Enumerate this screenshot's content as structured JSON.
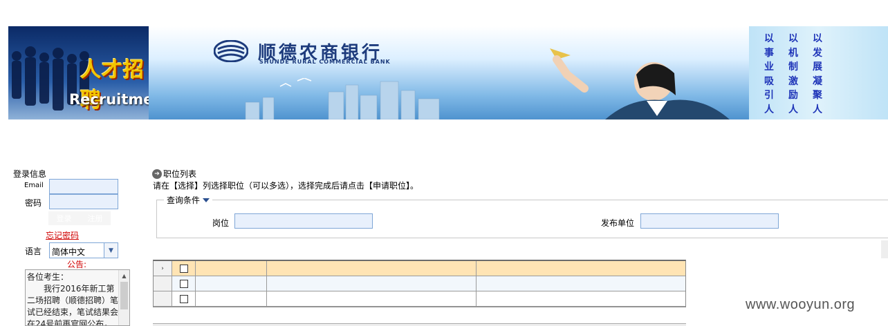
{
  "banner": {
    "recruit_cn": "人才招聘",
    "recruit_en": "Recruitment",
    "bank_name_cn": "顺德农商银行",
    "bank_name_en": "SHUNDE RURAL COMMERCIAL BANK",
    "motto_columns": [
      [
        "以",
        "事",
        "业",
        "吸",
        "引",
        "人"
      ],
      [
        "以",
        "机",
        "制",
        "激",
        "励",
        "人"
      ],
      [
        "以",
        "发",
        "展",
        "凝",
        "聚",
        "人"
      ]
    ]
  },
  "login": {
    "title": "登录信息",
    "email_label": "Email",
    "email_value": "",
    "password_label": "密码",
    "password_value": "",
    "login_button": "登录",
    "register_button": "注册",
    "forgot_link": "忘记密码",
    "language_label": "语言",
    "language_value": "简体中文",
    "notice_title": "公告:",
    "notice_text": "各位考生：\n　　我行2016年新工第二场招聘（顺德招聘）笔试已经结束，笔试结果会在24号前再官网公布，届时请留意……"
  },
  "main": {
    "section_title": "职位列表",
    "instruction": "请在【选择】列选择职位（可以多选），选择完成后请点击【申请职位】。",
    "query_legend": "查询条件",
    "post_label": "岗位",
    "post_value": "",
    "org_label": "发布单位",
    "org_value": "",
    "grid_rows": [
      {
        "selected": true,
        "indicator": "›"
      },
      {
        "selected": false,
        "indicator": ""
      },
      {
        "selected": false,
        "indicator": ""
      }
    ]
  },
  "watermark": "www.wooyun.org",
  "colors": {
    "accent_red": "#d00000",
    "input_bg": "#e8f0fc",
    "input_border": "#7ea6d6",
    "selected_row": "#ffe4b4"
  }
}
